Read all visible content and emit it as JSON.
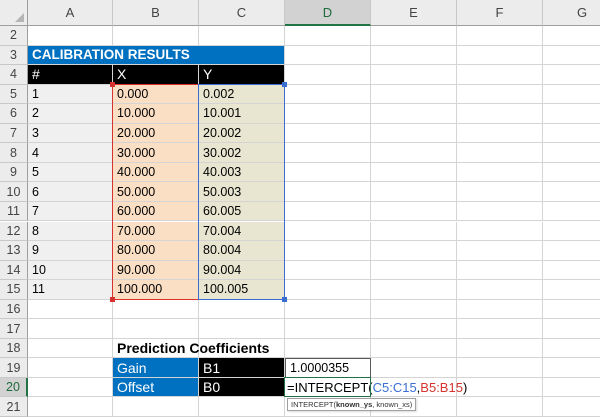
{
  "sheet": {
    "columns": [
      "A",
      "B",
      "C",
      "D",
      "E",
      "F",
      "G"
    ],
    "active_column": "D",
    "rows": [
      "2",
      "3",
      "4",
      "5",
      "6",
      "7",
      "8",
      "9",
      "10",
      "11",
      "12",
      "13",
      "14",
      "15",
      "16",
      "17",
      "18",
      "19",
      "20",
      "21"
    ],
    "active_row": "20"
  },
  "calibration": {
    "title": "CALIBRATION RESULTS",
    "headers": [
      "#",
      "X",
      "Y"
    ],
    "rows": [
      [
        "1",
        "0.000",
        "0.002"
      ],
      [
        "2",
        "10.000",
        "10.001"
      ],
      [
        "3",
        "20.000",
        "20.002"
      ],
      [
        "4",
        "30.000",
        "30.002"
      ],
      [
        "5",
        "40.000",
        "40.003"
      ],
      [
        "6",
        "50.000",
        "50.003"
      ],
      [
        "7",
        "60.000",
        "60.005"
      ],
      [
        "8",
        "70.000",
        "70.004"
      ],
      [
        "9",
        "80.000",
        "80.004"
      ],
      [
        "10",
        "90.000",
        "90.004"
      ],
      [
        "11",
        "100.000",
        "100.005"
      ]
    ]
  },
  "prediction": {
    "title": "Prediction Coefficients",
    "gain_label": "Gain",
    "gain_ref": "B1",
    "gain_value": "1.0000355",
    "offset_label": "Offset",
    "offset_ref": "B0",
    "formula": {
      "prefix": "=INTERCEPT(",
      "arg1": "C5:C15",
      "sep": ",",
      "arg2": "B5:B15",
      "suffix": ")"
    },
    "tooltip": {
      "fn": "INTERCEPT(",
      "arg1": "known_ys",
      "rest": ", known_xs)"
    }
  },
  "colors": {
    "title_bg": "#0070c0",
    "header_bg": "#000000",
    "x_fill": "#fbdfc4",
    "y_fill": "#e8e6d0",
    "index_fill": "#f0f0f0",
    "ref_blue": "#3a6fd1",
    "ref_red": "#d6332e",
    "active_green": "#217346"
  }
}
